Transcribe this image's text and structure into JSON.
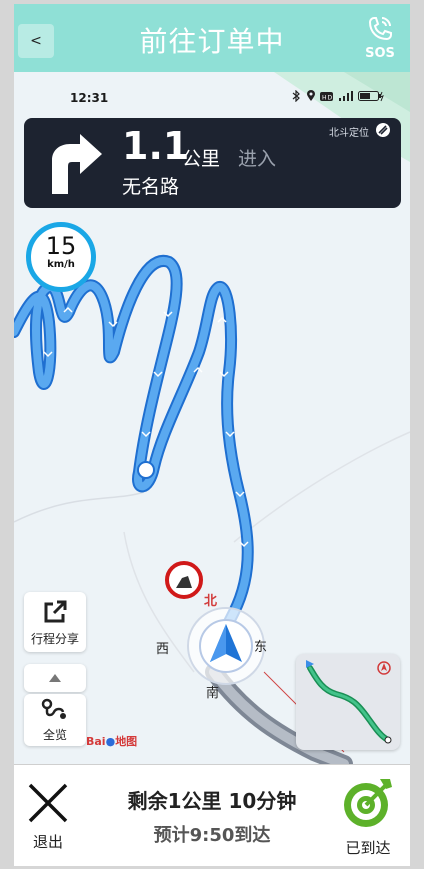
{
  "header": {
    "back_label": "<",
    "title": "前往订单中",
    "sos_label": "SOS",
    "back_icon": "back-icon",
    "phone_icon": "phone-sos-icon"
  },
  "status_bar": {
    "time": "12:31",
    "icons": [
      "bluetooth-icon",
      "location-icon",
      "hd-icon",
      "signal-icon",
      "battery-icon"
    ]
  },
  "navigation": {
    "turn_icon": "turn-right-arrow-icon",
    "distance": "1.1",
    "unit": "公里",
    "action": "进入",
    "road_name": "无名路",
    "positioning_label": "北斗定位"
  },
  "speed": {
    "value": "15",
    "unit": "km/h"
  },
  "map": {
    "compass": {
      "north": "北",
      "south": "南",
      "east": "东",
      "west": "西"
    },
    "route_color": "#3f8fe0",
    "background_color": "#edf3f7",
    "logo_text": "Bai",
    "logo_text_2": "地图"
  },
  "map_controls": {
    "share_label": "行程分享",
    "overview_label": "全览",
    "zoom_up_icon": "triangle-up-icon"
  },
  "trip": {
    "remaining": "剩余1公里 10分钟",
    "eta": "预计9:50到达"
  },
  "bottom_bar": {
    "exit_label": "退出",
    "arrived_label": "已到达",
    "arrived_color": "#5db12a"
  },
  "colors": {
    "header_bg": "#8fe0d6",
    "nav_panel_bg": "#1d2330",
    "speed_ring": "#1aa7e6"
  }
}
